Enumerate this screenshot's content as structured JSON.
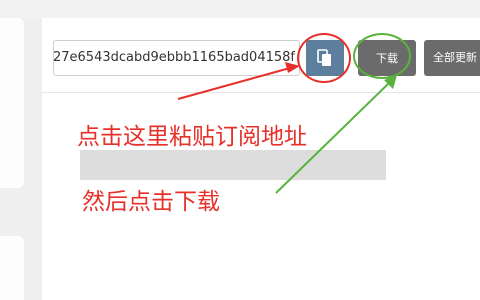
{
  "subscription": {
    "url_value": "27e6543dcabd9ebbb1165bad04158f",
    "paste_icon": "paste-icon"
  },
  "toolbar": {
    "download_label": "下载",
    "update_all_label": "全部更新"
  },
  "annotations": {
    "step1": "点击这里粘贴订阅地址",
    "step2": "然后点击下载"
  },
  "colors": {
    "annotation_red": "#e8302a",
    "annotation_green": "#58b33c",
    "paste_button": "#5d7e9d",
    "dark_button": "#6b6b6b"
  }
}
